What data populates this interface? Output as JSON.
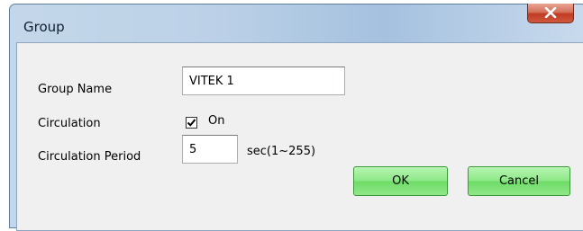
{
  "window": {
    "title": "Group",
    "close_glyph": "x"
  },
  "form": {
    "group_name": {
      "label": "Group Name",
      "value": "VITEK 1"
    },
    "circulation": {
      "label": "Circulation",
      "checked": true,
      "checkbox_label": "On"
    },
    "circulation_period": {
      "label": "Circulation Period",
      "value": "5",
      "unit": "sec(1~255)"
    }
  },
  "buttons": {
    "ok": "OK",
    "cancel": "Cancel"
  },
  "colors": {
    "button_green": "#8ee888",
    "close_red": "#c8452e",
    "dialog_bg": "#f0f0f0"
  },
  "icons": {
    "close": "close-icon",
    "check": "checkmark-icon"
  }
}
